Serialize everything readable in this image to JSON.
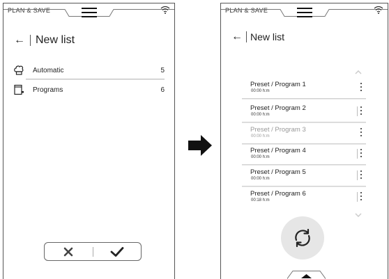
{
  "left_screen": {
    "brand": "PLAN & SAVE",
    "title": "New list",
    "modes": [
      {
        "label": "Automatic",
        "count": "5",
        "icon": "chef-hat-icon"
      },
      {
        "label": "Programs",
        "count": "6",
        "icon": "oven-icon"
      }
    ],
    "confirm": {
      "cancel_icon": "close-icon",
      "ok_icon": "checkmark-icon"
    }
  },
  "right_screen": {
    "brand": "PLAN & SAVE",
    "title": "New list",
    "programs": [
      {
        "name": "Preset / Program 1",
        "time": "00:00 h:m",
        "muted": false
      },
      {
        "name": "Preset / Program 2",
        "time": "00:00 h:m",
        "muted": false
      },
      {
        "name": "Preset / Program 3",
        "time": "00:00 h:m",
        "muted": true
      },
      {
        "name": "Preset / Program 4",
        "time": "00:00 h:m",
        "muted": false
      },
      {
        "name": "Preset / Program 5",
        "time": "00:00 h:m",
        "muted": false
      },
      {
        "name": "Preset / Program 6",
        "time": "00:18 h:m",
        "muted": false
      }
    ],
    "refresh_icon": "refresh-icon"
  },
  "transition_icon": "right-arrow-icon"
}
